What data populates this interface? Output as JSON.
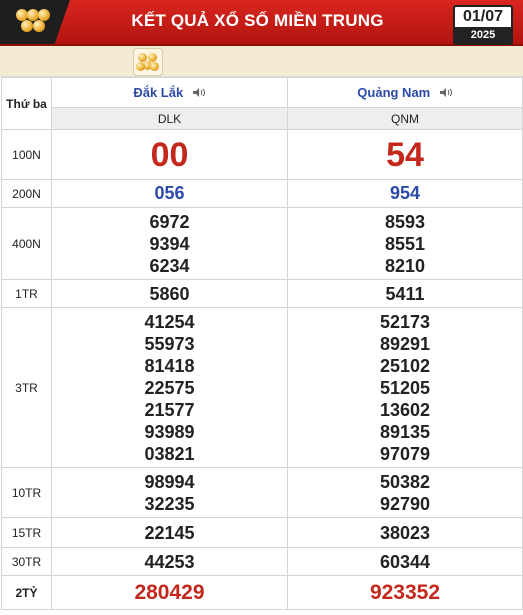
{
  "header": {
    "title": "KẾT QUẢ XỔ SỐ MIỀN TRUNG",
    "date": "01/07",
    "year": "2025"
  },
  "weekday": "Thứ ba",
  "provinces": [
    {
      "name": "Đắk Lắk",
      "code": "DLK"
    },
    {
      "name": "Quảng Nam",
      "code": "QNM"
    }
  ],
  "prizes": {
    "p100n": {
      "label": "100N",
      "values": [
        "00",
        "54"
      ]
    },
    "p200n": {
      "label": "200N",
      "values": [
        "056",
        "954"
      ]
    },
    "p400n": {
      "label": "400N",
      "values": [
        [
          "6972",
          "9394",
          "6234"
        ],
        [
          "8593",
          "8551",
          "8210"
        ]
      ]
    },
    "p1tr": {
      "label": "1TR",
      "values": [
        "5860",
        "5411"
      ]
    },
    "p3tr": {
      "label": "3TR",
      "values": [
        [
          "41254",
          "55973",
          "81418",
          "22575",
          "21577",
          "93989",
          "03821"
        ],
        [
          "52173",
          "89291",
          "25102",
          "51205",
          "13602",
          "89135",
          "97079"
        ]
      ]
    },
    "p10tr": {
      "label": "10TR",
      "values": [
        [
          "98994",
          "32235"
        ],
        [
          "50382",
          "92790"
        ]
      ]
    },
    "p15tr": {
      "label": "15TR",
      "values": [
        "22145",
        "38023"
      ]
    },
    "p30tr": {
      "label": "30TR",
      "values": [
        "44253",
        "60344"
      ]
    },
    "p2ty": {
      "label": "2TỶ",
      "values": [
        "280429",
        "923352"
      ]
    }
  }
}
